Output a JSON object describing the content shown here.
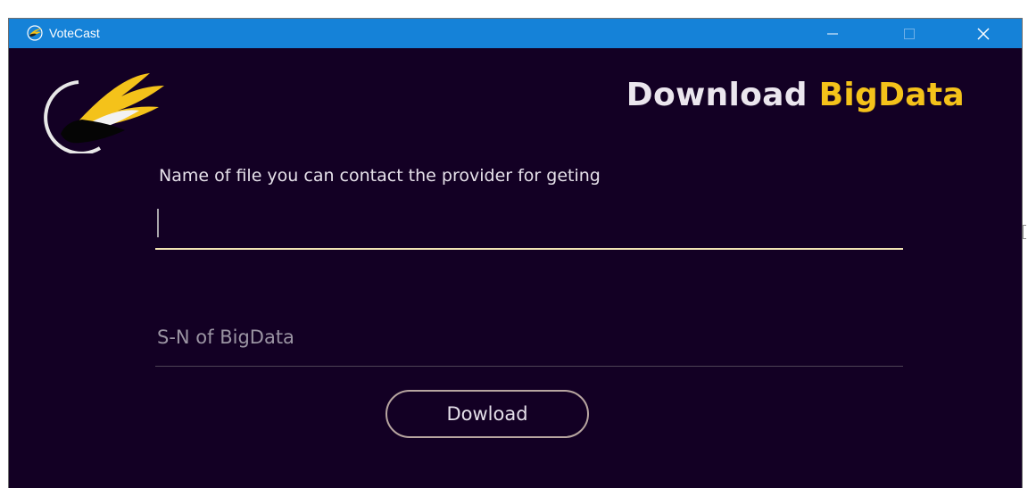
{
  "window": {
    "title": "VoteCast",
    "icon": "votecast-logo-icon",
    "controls": [
      "minimize-icon",
      "maximize-icon",
      "close-icon"
    ]
  },
  "page": {
    "heading_part1": "Download",
    "heading_part2": "BigData",
    "logo_icon": "votecast-bird-logo-icon"
  },
  "form": {
    "file_label": "Name of file you can contact the provider for geting",
    "file_value": "",
    "sn_placeholder": "S-N of BigData",
    "sn_value": "",
    "download_label": "Dowload"
  },
  "colors": {
    "titlebar": "#1582d8",
    "background": "#130024",
    "accent": "#f4c21a",
    "input_underline": "#f1e4b4"
  }
}
